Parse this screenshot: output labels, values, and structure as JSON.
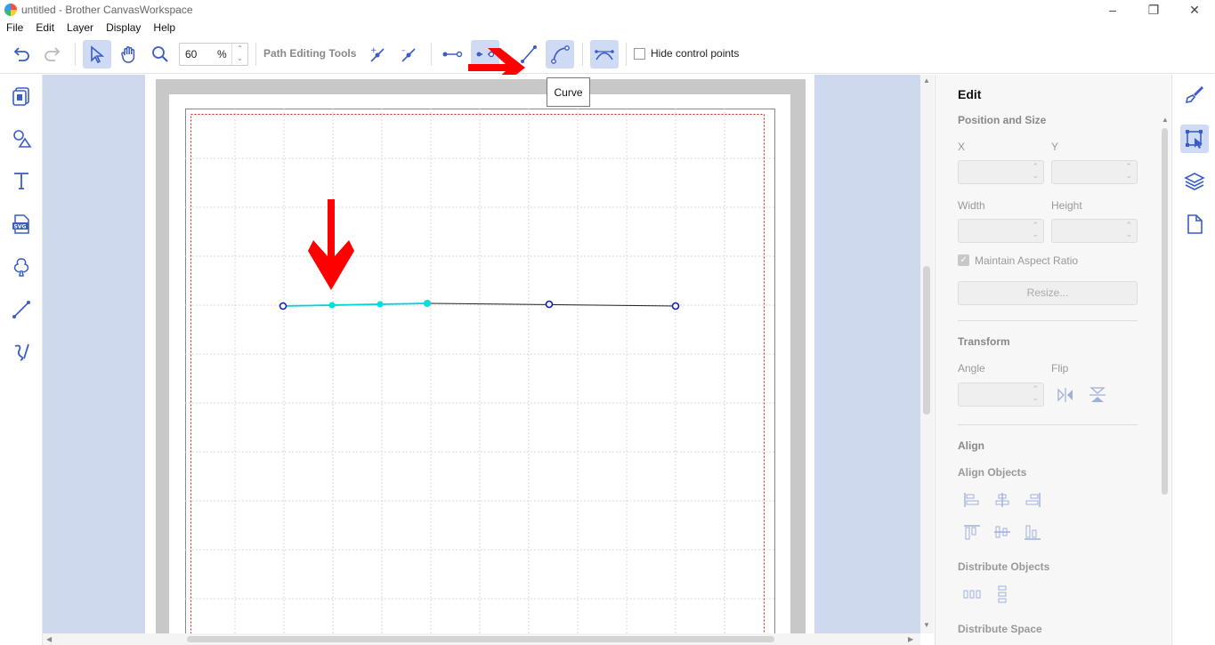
{
  "window": {
    "title": "untitled - Brother CanvasWorkspace"
  },
  "menu": {
    "items": [
      "File",
      "Edit",
      "Layer",
      "Display",
      "Help"
    ]
  },
  "toolbar": {
    "zoom_value": "60",
    "zoom_unit": "%",
    "path_editing_label": "Path Editing Tools",
    "hide_control_points_label": "Hide control points",
    "tooltip": "Curve"
  },
  "panel": {
    "title": "Edit",
    "position_size": "Position and Size",
    "x_label": "X",
    "y_label": "Y",
    "width_label": "Width",
    "height_label": "Height",
    "maintain_aspect": "Maintain Aspect Ratio",
    "resize_button": "Resize...",
    "transform": "Transform",
    "angle_label": "Angle",
    "flip_label": "Flip",
    "align": "Align",
    "align_objects": "Align Objects",
    "distribute_objects": "Distribute Objects",
    "distribute_space": "Distribute Space"
  },
  "colors": {
    "accent": "#3a5cc7",
    "active_bg": "#cfdbf5",
    "selected_path": "#00d4d4",
    "annotation_arrow": "#ff0000",
    "cut_boundary": "#cc2222"
  },
  "icons": {
    "left_bar": [
      "project-icon",
      "shapes-icon",
      "text-icon",
      "svg-import-icon",
      "pattern-icon",
      "line-icon",
      "freehand-icon"
    ],
    "right_bar": [
      "paint-icon",
      "edit-icon",
      "layers-icon",
      "page-icon"
    ]
  }
}
